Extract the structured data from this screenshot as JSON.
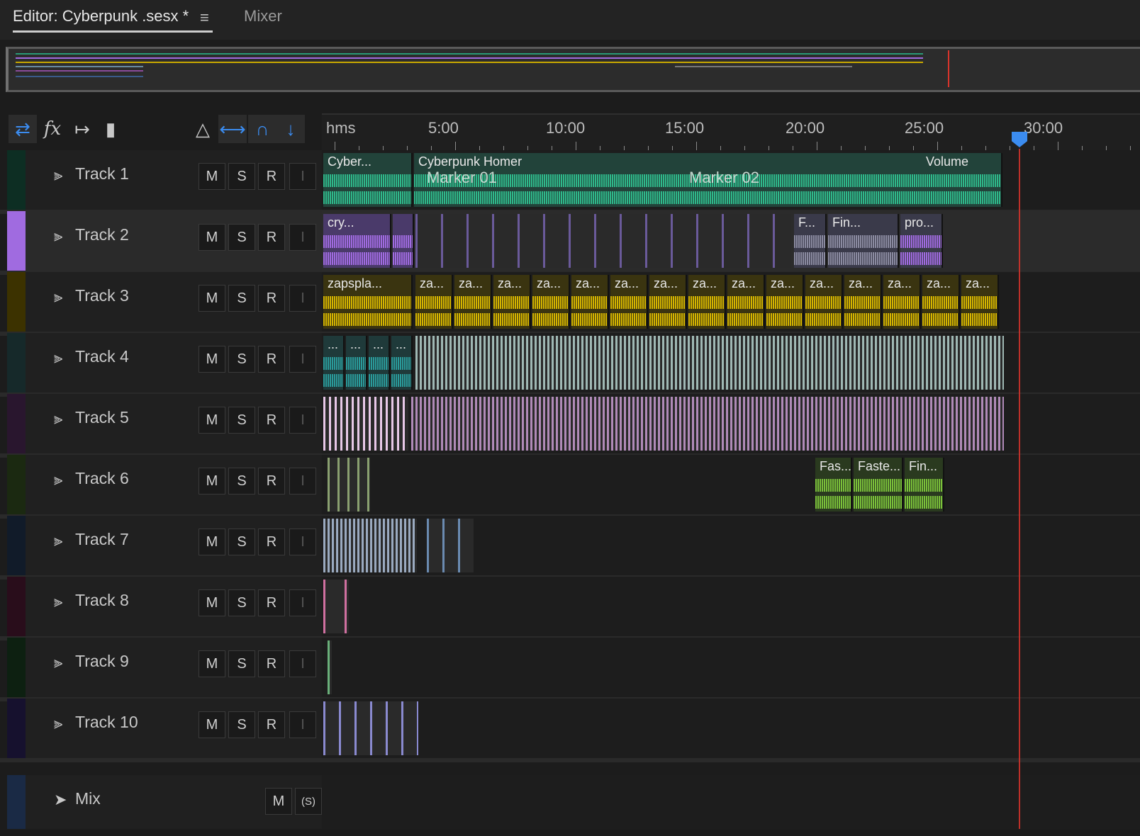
{
  "tabs": {
    "active": "Editor: Cyberpunk .sesx *",
    "menu_icon": "≡",
    "mixer": "Mixer"
  },
  "toolbar": {
    "icons": [
      "swap-arrows-icon",
      "fx-icon",
      "send-icon",
      "meter-icon",
      "metronome-icon",
      "time-select-icon",
      "snap-magnet-icon",
      "marker-pin-icon"
    ]
  },
  "ruler": {
    "unit_label": "hms",
    "labels": [
      "5:00",
      "10:00",
      "15:00",
      "20:00",
      "25:00",
      "30:00"
    ]
  },
  "track_buttons": {
    "m": "M",
    "s": "S",
    "r": "R",
    "i": "I"
  },
  "tracks": [
    {
      "name": "Track 1",
      "color": "#2a9a76"
    },
    {
      "name": "Track 2",
      "color": "#a06be0"
    },
    {
      "name": "Track 3",
      "color": "#c8a800"
    },
    {
      "name": "Track 4",
      "color": "#4a8a8c"
    },
    {
      "name": "Track 5",
      "color": "#8a4a9a"
    },
    {
      "name": "Track 6",
      "color": "#5a8a3a"
    },
    {
      "name": "Track 7",
      "color": "#3a5a8a"
    },
    {
      "name": "Track 8",
      "color": "#8a2a5a"
    },
    {
      "name": "Track 9",
      "color": "#2a6a3a"
    },
    {
      "name": "Track 10",
      "color": "#4a3a9a"
    }
  ],
  "mix": {
    "name": "Mix",
    "m": "M",
    "s": "(S)"
  },
  "clips": {
    "track1_a": "Cyber...",
    "track1_b": "Cyberpunk Homer",
    "track1_volume": "Volume",
    "marker1": "Marker 01",
    "marker2": "Marker 02",
    "track2_a": "cry...",
    "track2_b": "F...",
    "track2_c": "Fin...",
    "track2_d": "pro...",
    "track3_a": "zapspla...",
    "track3_short": "za...",
    "track4_short": "...",
    "track6_a": "Fas...",
    "track6_b": "Faste...",
    "track6_c": "Fin..."
  }
}
